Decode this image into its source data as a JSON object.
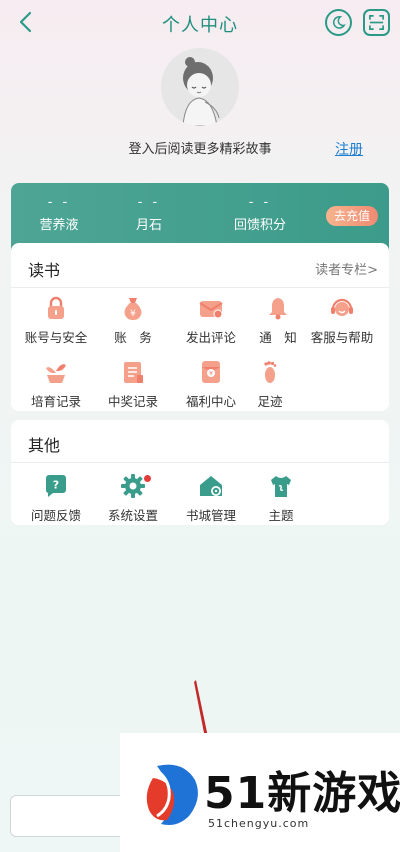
{
  "header": {
    "title": "个人中心",
    "back_icon": "chevron-left-icon",
    "night_icon": "moon-icon",
    "scan_icon": "scan-icon",
    "accent": "#2a9a88"
  },
  "profile": {
    "login_hint": "登入后阅读更多精彩故事",
    "register_label": "注册"
  },
  "stats": {
    "items": [
      {
        "value": "- -",
        "label": "营养液"
      },
      {
        "value": "- -",
        "label": "月石"
      },
      {
        "value": "- -",
        "label": "回馈积分"
      }
    ],
    "recharge_label": "去充值"
  },
  "reading": {
    "title": "读书",
    "more_label": "读者专栏>",
    "items": [
      {
        "label": "账号与安全",
        "icon": "lock-icon"
      },
      {
        "label": "账　务",
        "icon": "money-bag-icon"
      },
      {
        "label": "发出评论",
        "icon": "envelope-icon"
      },
      {
        "label": "通　知",
        "icon": "bell-icon"
      },
      {
        "label": "客服与帮助",
        "icon": "headset-icon"
      },
      {
        "label": "培育记录",
        "icon": "sprout-icon"
      },
      {
        "label": "中奖记录",
        "icon": "list-icon"
      },
      {
        "label": "福利中心",
        "icon": "red-packet-icon"
      },
      {
        "label": "足迹",
        "icon": "footprint-icon"
      }
    ]
  },
  "other": {
    "title": "其他",
    "items": [
      {
        "label": "问题反馈",
        "icon": "question-icon"
      },
      {
        "label": "系统设置",
        "icon": "gear-icon"
      },
      {
        "label": "书城管理",
        "icon": "house-gear-icon"
      },
      {
        "label": "主题",
        "icon": "shirt-icon"
      }
    ]
  },
  "watermark": {
    "brand": "51新游戏",
    "url": "51chengyu.com"
  }
}
